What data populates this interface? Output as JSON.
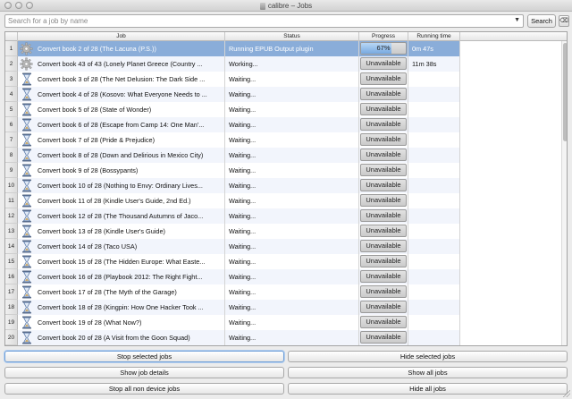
{
  "window": {
    "title": "calibre – Jobs"
  },
  "search": {
    "placeholder": "Search for a job by name",
    "button_label": "Search",
    "clear_icon": "clear-search-icon"
  },
  "table": {
    "headers": {
      "job": "Job",
      "status": "Status",
      "progress": "Progress",
      "time": "Running time"
    },
    "rows": [
      {
        "num": "1",
        "icon": "gear-icon",
        "job": "Convert book 2 of 28 (The Lacuna (P.S.))",
        "status": "Running EPUB Output plugin",
        "progress": "67%",
        "progress_value": 67,
        "time": "0m 47s"
      },
      {
        "num": "2",
        "icon": "gear-icon",
        "job": "Convert book 43 of 43 (Lonely Planet Greece (Country ...",
        "status": "Working...",
        "progress": "Unavailable",
        "time": "11m 38s"
      },
      {
        "num": "3",
        "icon": "hourglass-icon",
        "job": "Convert book 3 of 28 (The Net Delusion: The Dark Side ...",
        "status": "Waiting...",
        "progress": "Unavailable",
        "time": ""
      },
      {
        "num": "4",
        "icon": "hourglass-icon",
        "job": "Convert book 4 of 28 (Kosovo: What Everyone Needs to ...",
        "status": "Waiting...",
        "progress": "Unavailable",
        "time": ""
      },
      {
        "num": "5",
        "icon": "hourglass-icon",
        "job": "Convert book 5 of 28 (State of Wonder)",
        "status": "Waiting...",
        "progress": "Unavailable",
        "time": ""
      },
      {
        "num": "6",
        "icon": "hourglass-icon",
        "job": "Convert book 6 of 28 (Escape from Camp 14: One Man'...",
        "status": "Waiting...",
        "progress": "Unavailable",
        "time": ""
      },
      {
        "num": "7",
        "icon": "hourglass-icon",
        "job": "Convert book 7 of 28 (Pride & Prejudice)",
        "status": "Waiting...",
        "progress": "Unavailable",
        "time": ""
      },
      {
        "num": "8",
        "icon": "hourglass-icon",
        "job": "Convert book 8 of 28 (Down and Delirious in Mexico City)",
        "status": "Waiting...",
        "progress": "Unavailable",
        "time": ""
      },
      {
        "num": "9",
        "icon": "hourglass-icon",
        "job": "Convert book 9 of 28 (Bossypants)",
        "status": "Waiting...",
        "progress": "Unavailable",
        "time": ""
      },
      {
        "num": "10",
        "icon": "hourglass-icon",
        "job": "Convert book 10 of 28 (Nothing to Envy: Ordinary Lives...",
        "status": "Waiting...",
        "progress": "Unavailable",
        "time": ""
      },
      {
        "num": "11",
        "icon": "hourglass-icon",
        "job": "Convert book 11 of 28 (Kindle User's Guide, 2nd Ed.)",
        "status": "Waiting...",
        "progress": "Unavailable",
        "time": ""
      },
      {
        "num": "12",
        "icon": "hourglass-icon",
        "job": "Convert book 12 of 28 (The Thousand Autumns of Jaco...",
        "status": "Waiting...",
        "progress": "Unavailable",
        "time": ""
      },
      {
        "num": "13",
        "icon": "hourglass-icon",
        "job": "Convert book 13 of 28 (Kindle User's Guide)",
        "status": "Waiting...",
        "progress": "Unavailable",
        "time": ""
      },
      {
        "num": "14",
        "icon": "hourglass-icon",
        "job": "Convert book 14 of 28 (Taco USA)",
        "status": "Waiting...",
        "progress": "Unavailable",
        "time": ""
      },
      {
        "num": "15",
        "icon": "hourglass-icon",
        "job": "Convert book 15 of 28 (The Hidden Europe: What Easte...",
        "status": "Waiting...",
        "progress": "Unavailable",
        "time": ""
      },
      {
        "num": "16",
        "icon": "hourglass-icon",
        "job": "Convert book 16 of 28 (Playbook 2012: The Right Fight...",
        "status": "Waiting...",
        "progress": "Unavailable",
        "time": ""
      },
      {
        "num": "17",
        "icon": "hourglass-icon",
        "job": "Convert book 17 of 28 (The Myth of the Garage)",
        "status": "Waiting...",
        "progress": "Unavailable",
        "time": ""
      },
      {
        "num": "18",
        "icon": "hourglass-icon",
        "job": "Convert book 18 of 28 (Kingpin: How One Hacker Took ...",
        "status": "Waiting...",
        "progress": "Unavailable",
        "time": ""
      },
      {
        "num": "19",
        "icon": "hourglass-icon",
        "job": "Convert book 19 of 28 (What Now?)",
        "status": "Waiting...",
        "progress": "Unavailable",
        "time": ""
      },
      {
        "num": "20",
        "icon": "hourglass-icon",
        "job": "Convert book 20 of 28 (A Visit from the Goon Squad)",
        "status": "Waiting...",
        "progress": "Unavailable",
        "time": ""
      }
    ]
  },
  "buttons": {
    "stop_selected": "Stop selected jobs",
    "hide_selected": "Hide selected jobs",
    "show_details": "Show job details",
    "show_all": "Show all jobs",
    "stop_all_non_device": "Stop all non device jobs",
    "hide_all": "Hide all jobs"
  },
  "colors": {
    "selection": "#8aadd9",
    "alt_row": "#f2f5fc",
    "progress_fill": "#77a9e0"
  }
}
